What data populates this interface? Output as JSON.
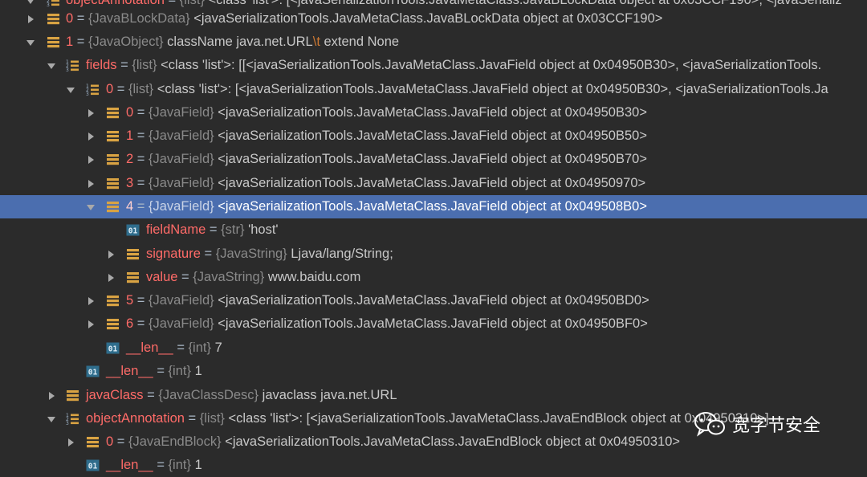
{
  "tree": {
    "rows": [
      {
        "key": "objectAnnotation",
        "type": "{list}",
        "before": "<class 'list'>: [<javaSerializationTools.JavaMetaClass.JavaBLockData object at 0x03CCF190>, <javaSerializ",
        "after": "",
        "expanded": true,
        "kind": "list",
        "selected": false
      },
      {
        "key": "0",
        "type": "{JavaBLockData}",
        "before": "<javaSerializationTools.JavaMetaClass.JavaBLockData object at 0x03CCF190>",
        "after": "",
        "expanded": false,
        "kind": "object",
        "selected": false
      },
      {
        "key": "1",
        "type": "{JavaObject}",
        "before": "className java.net.URL",
        "escape": "\\t",
        "after": " extend None",
        "expanded": true,
        "kind": "object",
        "selected": false
      },
      {
        "key": "fields",
        "type": "{list}",
        "before": "<class 'list'>: [[<javaSerializationTools.JavaMetaClass.JavaField object at 0x04950B30>, <javaSerializationTools.",
        "after": "",
        "expanded": true,
        "kind": "list",
        "selected": false
      },
      {
        "key": "0",
        "type": "{list}",
        "before": "<class 'list'>: [<javaSerializationTools.JavaMetaClass.JavaField object at 0x04950B30>, <javaSerializationTools.Ja",
        "after": "",
        "expanded": true,
        "kind": "list",
        "selected": false
      },
      {
        "key": "0",
        "type": "{JavaField}",
        "before": "<javaSerializationTools.JavaMetaClass.JavaField object at 0x04950B30>",
        "after": "",
        "expanded": false,
        "kind": "object",
        "selected": false
      },
      {
        "key": "1",
        "type": "{JavaField}",
        "before": "<javaSerializationTools.JavaMetaClass.JavaField object at 0x04950B50>",
        "after": "",
        "expanded": false,
        "kind": "object",
        "selected": false
      },
      {
        "key": "2",
        "type": "{JavaField}",
        "before": "<javaSerializationTools.JavaMetaClass.JavaField object at 0x04950B70>",
        "after": "",
        "expanded": false,
        "kind": "object",
        "selected": false
      },
      {
        "key": "3",
        "type": "{JavaField}",
        "before": "<javaSerializationTools.JavaMetaClass.JavaField object at 0x04950970>",
        "after": "",
        "expanded": false,
        "kind": "object",
        "selected": false
      },
      {
        "key": "4",
        "type": "{JavaField}",
        "before": "<javaSerializationTools.JavaMetaClass.JavaField object at 0x049508B0>",
        "after": "",
        "expanded": true,
        "kind": "object",
        "selected": true
      },
      {
        "key": "fieldName",
        "type": "{str}",
        "before": "'host'",
        "after": "",
        "expanded": null,
        "kind": "primitive",
        "selected": false
      },
      {
        "key": "signature",
        "type": "{JavaString}",
        "before": "Ljava/lang/String;",
        "after": "",
        "expanded": false,
        "kind": "object",
        "selected": false
      },
      {
        "key": "value",
        "type": "{JavaString}",
        "before": "www.baidu.com",
        "after": "",
        "expanded": false,
        "kind": "object",
        "selected": false
      },
      {
        "key": "5",
        "type": "{JavaField}",
        "before": "<javaSerializationTools.JavaMetaClass.JavaField object at 0x04950BD0>",
        "after": "",
        "expanded": false,
        "kind": "object",
        "selected": false
      },
      {
        "key": "6",
        "type": "{JavaField}",
        "before": "<javaSerializationTools.JavaMetaClass.JavaField object at 0x04950BF0>",
        "after": "",
        "expanded": false,
        "kind": "object",
        "selected": false
      },
      {
        "key": "__len__",
        "type": "{int}",
        "before": "7",
        "after": "",
        "expanded": null,
        "kind": "primitive",
        "selected": false
      },
      {
        "key": "__len__",
        "type": "{int}",
        "before": "1",
        "after": "",
        "expanded": null,
        "kind": "primitive",
        "selected": false
      },
      {
        "key": "javaClass",
        "type": "{JavaClassDesc}",
        "before": "javaclass java.net.URL",
        "after": "",
        "expanded": false,
        "kind": "object",
        "selected": false
      },
      {
        "key": "objectAnnotation",
        "type": "{list}",
        "before": "<class 'list'>: [<javaSerializationTools.JavaMetaClass.JavaEndBlock object at 0x04950310>]",
        "after": "",
        "expanded": true,
        "kind": "list",
        "selected": false
      },
      {
        "key": "0",
        "type": "{JavaEndBlock}",
        "before": "<javaSerializationTools.JavaMetaClass.JavaEndBlock object at 0x04950310>",
        "after": "",
        "expanded": false,
        "kind": "object",
        "selected": false
      },
      {
        "key": "__len__",
        "type": "{int}",
        "before": "1",
        "after": "",
        "expanded": null,
        "kind": "primitive",
        "selected": false
      }
    ]
  },
  "watermark": {
    "text": "宽字节安全",
    "icon": "wechat-icon"
  },
  "colors": {
    "background": "#2b2b2b",
    "selection": "#4b6eaf",
    "name": "#ff6b68",
    "type": "#8a8a8a",
    "value": "#c8c8c8",
    "object_icon": "#d9a343",
    "primitive_icon": "#2f6d8c"
  }
}
